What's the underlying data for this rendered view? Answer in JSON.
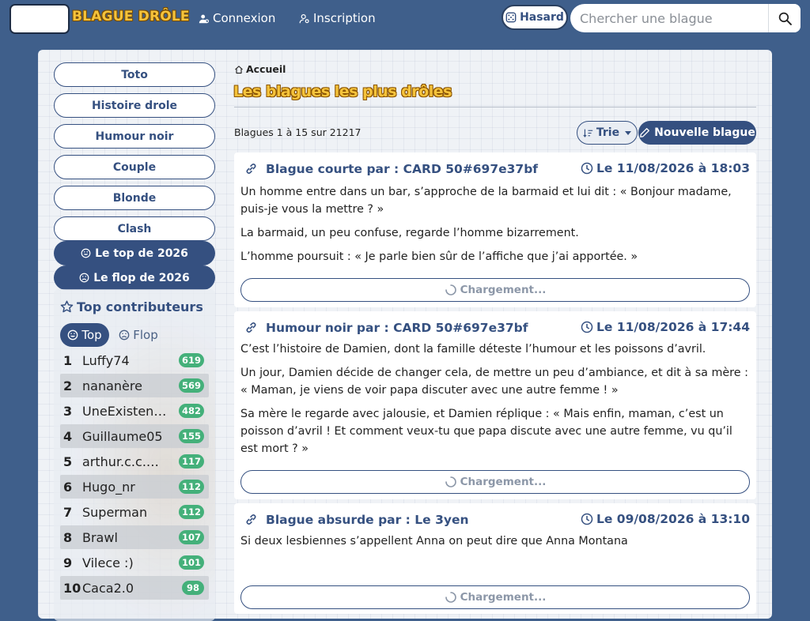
{
  "header": {
    "brand": "BLAGUE DRÔLE",
    "login_label": "Connexion",
    "signup_label": "Inscription",
    "random_label": "Hasard",
    "search_placeholder": "Chercher une blague"
  },
  "sidebar": {
    "categories": [
      "Toto",
      "Histoire drole",
      "Humour noir",
      "Couple",
      "Blonde",
      "Clash"
    ],
    "top_label": "Le top de 2026",
    "flop_label": "Le flop de 2026",
    "contributors": {
      "title": "Top contributeurs",
      "tab_top": "Top",
      "tab_flop": "Flop",
      "rows": [
        {
          "rank": "1",
          "name": "Luffy74",
          "score": "619"
        },
        {
          "rank": "2",
          "name": "nananère",
          "score": "569"
        },
        {
          "rank": "3",
          "name": "UneExistence…",
          "score": "482"
        },
        {
          "rank": "4",
          "name": "Guillaume05",
          "score": "155"
        },
        {
          "rank": "5",
          "name": "arthur.c.c.m…",
          "score": "117"
        },
        {
          "rank": "6",
          "name": "Hugo_nr",
          "score": "112"
        },
        {
          "rank": "7",
          "name": "Superman",
          "score": "112"
        },
        {
          "rank": "8",
          "name": "Brawl",
          "score": "107"
        },
        {
          "rank": "9",
          "name": "Vilece :)",
          "score": "101"
        },
        {
          "rank": "10",
          "name": "Caca2.0",
          "score": "98"
        }
      ]
    }
  },
  "main": {
    "breadcrumb": "Accueil",
    "title": "Les blagues les plus drôles",
    "count_text": "Blagues 1 à 15 sur 21217",
    "sort_label": "Trie",
    "new_label": "Nouvelle blague",
    "loading_label": "Chargement...",
    "jokes": [
      {
        "title": "Blague courte par : CARD 50#697e37bf",
        "date": "Le 11/08/2026 à 18:03",
        "paragraphs": [
          "Un homme entre dans un bar, s’approche de la barmaid et lui dit : « Bonjour madame, puis-je vous la mettre ? »",
          "La barmaid, un peu confuse, regarde l’homme bizarrement.",
          "L’homme poursuit : « Je parle bien sûr de l’affiche que j’ai apportée. »"
        ]
      },
      {
        "title": "Humour noir par : CARD 50#697e37bf",
        "date": "Le 11/08/2026 à 17:44",
        "paragraphs": [
          "C’est l’histoire de Damien, dont la famille déteste l’humour et les poissons d’avril.",
          "Un jour, Damien décide de changer cela, de mettre un peu d’ambiance, et dit à sa mère : « Maman, je viens de voir papa discuter avec une autre femme ! »",
          "Sa mère le regarde avec jalousie, et Damien réplique : « Mais enfin, maman, c’est un poisson d’avril ! Et comment veux-tu que papa discute avec une autre femme, vu qu’il est mort ? »"
        ]
      },
      {
        "title": "Blague absurde par : Le 3yen",
        "date": "Le 09/08/2026 à 13:10",
        "paragraphs": [
          "Si deux lesbiennes s’appellent Anna on peut dire que Anna Montana"
        ]
      }
    ]
  }
}
